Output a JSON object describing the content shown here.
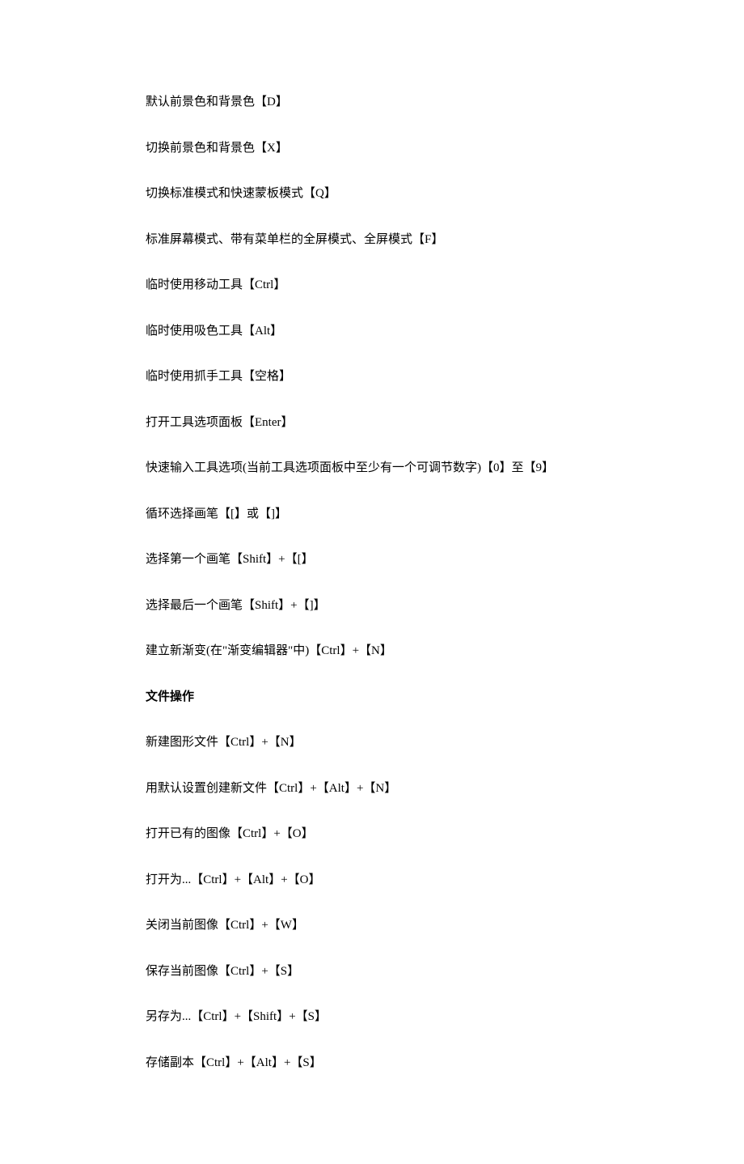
{
  "lines": [
    {
      "text": "默认前景色和背景色【D】",
      "bold": false
    },
    {
      "text": "切换前景色和背景色【X】",
      "bold": false
    },
    {
      "text": "切换标准模式和快速蒙板模式【Q】",
      "bold": false
    },
    {
      "text": "标准屏幕模式、带有菜单栏的全屏模式、全屏模式【F】",
      "bold": false
    },
    {
      "text": "临时使用移动工具【Ctrl】",
      "bold": false
    },
    {
      "text": "临时使用吸色工具【Alt】",
      "bold": false
    },
    {
      "text": "临时使用抓手工具【空格】",
      "bold": false
    },
    {
      "text": "打开工具选项面板【Enter】",
      "bold": false
    },
    {
      "text": "快速输入工具选项(当前工具选项面板中至少有一个可调节数字)【0】至【9】",
      "bold": false
    },
    {
      "text": "循环选择画笔【[】或【]】",
      "bold": false
    },
    {
      "text": "选择第一个画笔【Shift】+【[】",
      "bold": false
    },
    {
      "text": "选择最后一个画笔【Shift】+【]】",
      "bold": false
    },
    {
      "text": "建立新渐变(在\"渐变编辑器\"中)【Ctrl】+【N】",
      "bold": false
    },
    {
      "text": "文件操作",
      "bold": true
    },
    {
      "text": "新建图形文件【Ctrl】+【N】",
      "bold": false
    },
    {
      "text": "用默认设置创建新文件【Ctrl】+【Alt】+【N】",
      "bold": false
    },
    {
      "text": "打开已有的图像【Ctrl】+【O】",
      "bold": false
    },
    {
      "text": "打开为...【Ctrl】+【Alt】+【O】",
      "bold": false
    },
    {
      "text": "关闭当前图像【Ctrl】+【W】",
      "bold": false
    },
    {
      "text": "保存当前图像【Ctrl】+【S】",
      "bold": false
    },
    {
      "text": "另存为...【Ctrl】+【Shift】+【S】",
      "bold": false
    },
    {
      "text": "存储副本【Ctrl】+【Alt】+【S】",
      "bold": false
    }
  ]
}
